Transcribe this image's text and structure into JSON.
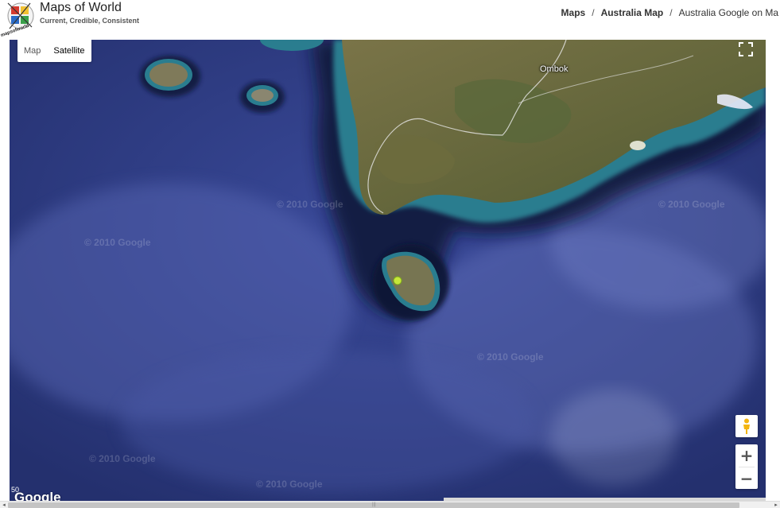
{
  "brand": {
    "title": "Maps of World",
    "tagline": "Current, Credible, Consistent",
    "logo_text": "mapsofworld.com"
  },
  "breadcrumb": {
    "items": [
      "Maps",
      "Australia Map"
    ],
    "current": "Australia Google on Ma",
    "separator": "/"
  },
  "map": {
    "type_buttons": [
      "Map",
      "Satellite"
    ],
    "active_type": "Satellite",
    "place_label": "Ombok",
    "watermarks": [
      "© 2010 Google",
      "© 2010 Google",
      "© 2010 Google",
      "© 2010 Google",
      "© 2010 Google",
      "© 2010 Google"
    ],
    "google_logo": "Google",
    "scale_num": "50",
    "zoom_in": "+",
    "zoom_out": "−",
    "icons": {
      "fullscreen": "fullscreen-icon",
      "pegman": "pegman-icon"
    }
  },
  "colors": {
    "ocean": "#2b3c8a",
    "land": "#6b6a3e",
    "shallow": "#2d8c9a"
  }
}
